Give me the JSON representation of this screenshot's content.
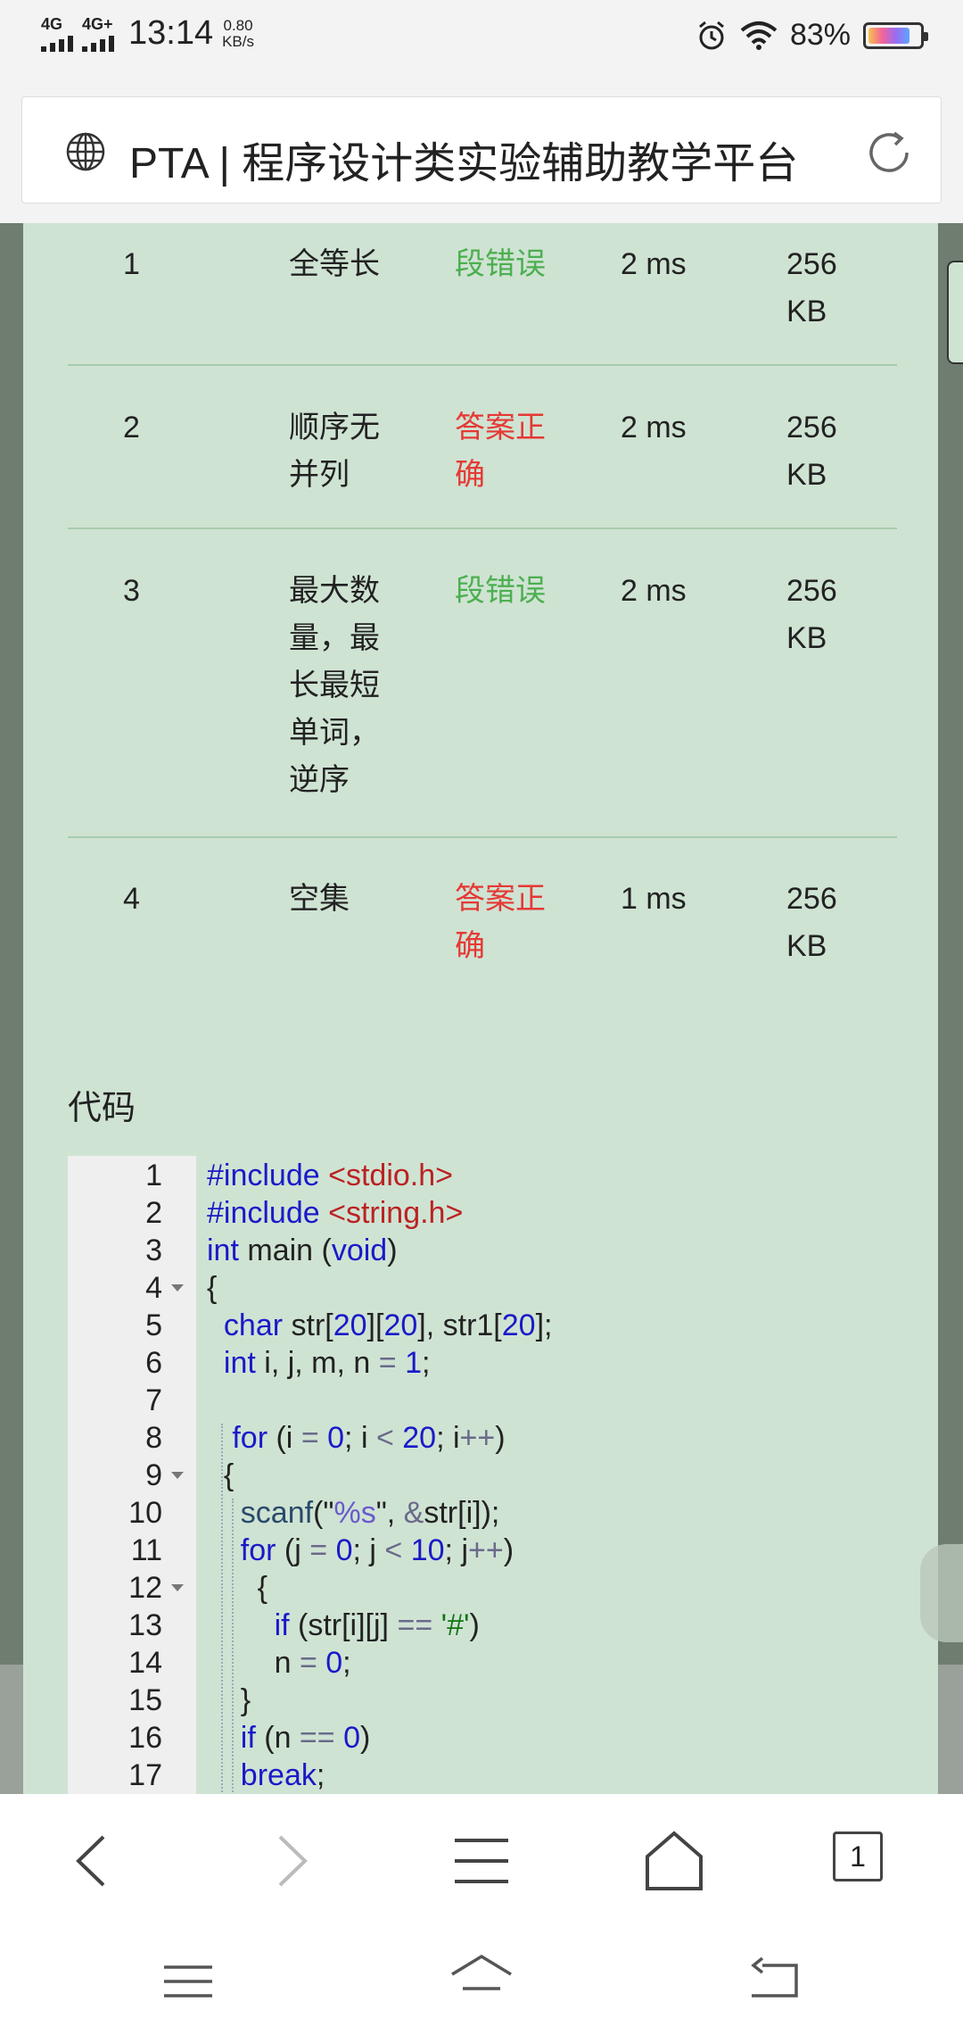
{
  "status_bar": {
    "network_1": "4G",
    "network_2": "4G+",
    "time": "13:14",
    "speed_value": "0.80",
    "speed_unit": "KB/s",
    "battery": "83%",
    "battery_level": 0.83
  },
  "address_bar": {
    "title": "PTA | 程序设计类实验辅助教学平台"
  },
  "results": [
    {
      "id": "1",
      "name_lines": [
        "全等长"
      ],
      "status_lines": [
        "段错误"
      ],
      "status_color": "#4caf50",
      "time": "2 ms",
      "mem_lines": [
        "256",
        "KB"
      ]
    },
    {
      "id": "2",
      "name_lines": [
        "顺序无",
        "并列"
      ],
      "status_lines": [
        "答案正",
        "确"
      ],
      "status_color": "#e53935",
      "time": "2 ms",
      "mem_lines": [
        "256",
        "KB"
      ]
    },
    {
      "id": "3",
      "name_lines": [
        "最大数",
        "量，最",
        "长最短",
        "单词，",
        "逆序"
      ],
      "status_lines": [
        "段错误"
      ],
      "status_color": "#4caf50",
      "time": "2 ms",
      "mem_lines": [
        "256",
        "KB"
      ]
    },
    {
      "id": "4",
      "name_lines": [
        "空集"
      ],
      "status_lines": [
        "答案正",
        "确"
      ],
      "status_color": "#e53935",
      "time": "1 ms",
      "mem_lines": [
        "256",
        "KB"
      ]
    }
  ],
  "code_section": {
    "title": "代码",
    "lines": [
      "#include <stdio.h>",
      "#include <string.h>",
      "int main (void)",
      "{",
      "  char str[20][20], str1[20];",
      "  int i, j, m, n = 1;",
      "",
      "   for (i = 0; i < 20; i++)",
      "  {",
      "    scanf(\"%s\", &str[i]);",
      "    for (j = 0; j < 10; j++)",
      "      {",
      "        if (str[i][j] == '#')",
      "        n = 0;",
      "    }",
      "    if (n == 0)",
      "    break;"
    ],
    "fold_lines": [
      4,
      9,
      12
    ]
  },
  "bottom_nav": {
    "tab_count": "1"
  }
}
